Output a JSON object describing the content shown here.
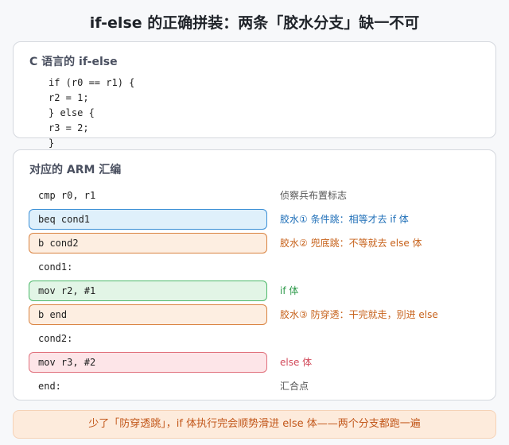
{
  "title": "if-else 的正确拼装：两条「胶水分支」缺一不可",
  "c_section": {
    "title": "C 语言的 if-else",
    "code": [
      "if (r0 == r1) {",
      "r2 = 1;",
      "} else {",
      "r3 = 2;",
      "}"
    ]
  },
  "arm_section": {
    "title": "对应的 ARM 汇编",
    "rows": [
      {
        "code": "cmp r0, r1",
        "note": "侦察兵布置标志",
        "style": "plain",
        "note_color": "#555555"
      },
      {
        "code": "beq cond1",
        "note": "胶水① 条件跳：相等才去 if 体",
        "style": "blue",
        "note_color": "#1f6fb8"
      },
      {
        "code": "b cond2",
        "note": "胶水② 兜底跳：不等就去 else 体",
        "style": "orange",
        "note_color": "#c7621b"
      },
      {
        "code": "cond1:",
        "note": "",
        "style": "plain",
        "note_color": "#555555"
      },
      {
        "code": "mov r2, #1",
        "note": "if 体",
        "style": "green",
        "note_color": "#2f9a4b"
      },
      {
        "code": "b end",
        "note": "胶水③ 防穿透：干完就走，别进 else",
        "style": "orange",
        "note_color": "#c7621b"
      },
      {
        "code": "cond2:",
        "note": "",
        "style": "plain",
        "note_color": "#555555"
      },
      {
        "code": "mov r3, #2",
        "note": "else 体",
        "style": "red",
        "note_color": "#d24a5a"
      },
      {
        "code": "end:",
        "note": "汇合点",
        "style": "plain",
        "note_color": "#555555"
      }
    ]
  },
  "footer": "少了「防穿透跳」，if 体执行完会顺势滑进 else 体——两个分支都跑一遍"
}
